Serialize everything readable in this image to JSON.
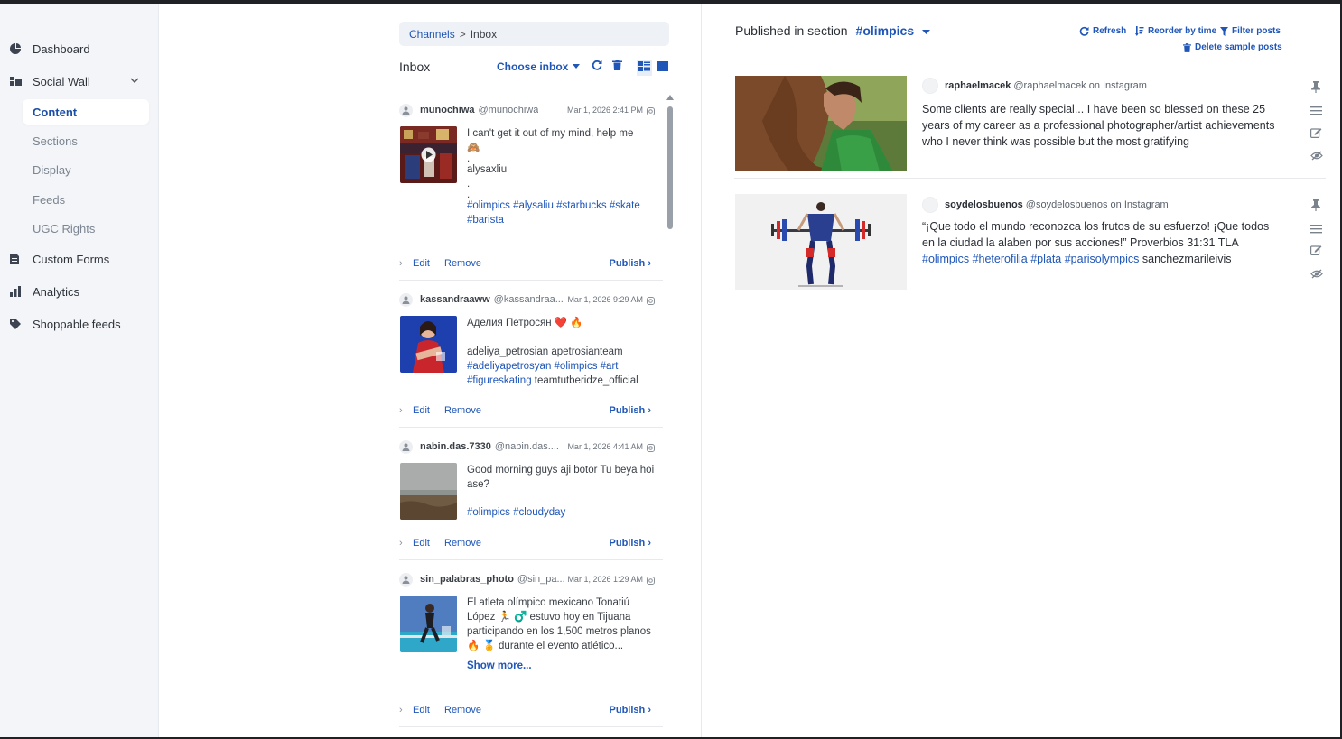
{
  "sidebar": {
    "items": [
      {
        "label": "Dashboard",
        "icon": "dashboard-icon"
      },
      {
        "label": "Social Wall",
        "icon": "social-wall-icon"
      },
      {
        "label": "Custom Forms",
        "icon": "form-icon"
      },
      {
        "label": "Analytics",
        "icon": "analytics-icon"
      },
      {
        "label": "Shoppable feeds",
        "icon": "tag-icon"
      }
    ],
    "social_wall_sub": [
      "Content",
      "Sections",
      "Display",
      "Feeds",
      "UGC Rights"
    ],
    "active_sub": "Content"
  },
  "breadcrumb": {
    "parent": "Channels",
    "separator": ">",
    "current": "Inbox"
  },
  "inbox": {
    "title": "Inbox",
    "choose_label": "Choose inbox",
    "cards": [
      {
        "name": "munochiwa",
        "handle": "@munochiwa",
        "date": "Mar 1, 2026 2:41 PM",
        "lines": [
          "I can't get it out of my mind, help me",
          "🙈",
          ".",
          "alysaxliu",
          ".",
          "."
        ],
        "tags": "#olimpics #alysaliu #starbucks #skate #barista",
        "edit": "Edit",
        "remove": "Remove",
        "publish": "Publish"
      },
      {
        "name": "kassandraaww",
        "handle": "@kassandraa...",
        "date": "Mar 1, 2026 9:29 AM",
        "lines": [
          "Аделия Петросян ❤️ 🔥",
          "",
          "adeliya_petrosian apetrosianteam"
        ],
        "tags": "#adeliyapetrosyan #olimpics #art #figureskating",
        "tail": " teamtutberidze_official",
        "edit": "Edit",
        "remove": "Remove",
        "publish": "Publish"
      },
      {
        "name": "nabin.das.7330",
        "handle": "@nabin.das....",
        "date": "Mar 1, 2026 4:41 AM",
        "lines": [
          "Good morning guys aji botor Tu beya hoi ase?",
          ""
        ],
        "tags": "#olimpics #cloudyday",
        "edit": "Edit",
        "remove": "Remove",
        "publish": "Publish"
      },
      {
        "name": "sin_palabras_photo",
        "handle": "@sin_pa...",
        "date": "Mar 1, 2026 1:29 AM",
        "lines": [
          "El atleta olímpico mexicano Tonatiú López 🏃 ♂️ estuvo hoy en Tijuana participando en los 1,500 metros planos 🔥 🏅 durante el evento atlético..."
        ],
        "show_more": "Show more...",
        "edit": "Edit",
        "remove": "Remove",
        "publish": "Publish"
      }
    ]
  },
  "published": {
    "prefix": "Published in section",
    "section": "#olimpics",
    "refresh": "Refresh",
    "reorder": "Reorder by time",
    "filter": "Filter posts",
    "delete_samples": "Delete sample posts",
    "posts": [
      {
        "name": "raphaelmacek",
        "handle": "@raphaelmacek on Instagram",
        "text": "Some clients are really special... I have been so blessed on these 25 years of my career as a professional photographer/artist achievements who I never think was possible but the most gratifying",
        "tags": "",
        "tail": ""
      },
      {
        "name": "soydelosbuenos",
        "handle": "@soydelosbuenos on Instagram",
        "text": "“¡Que todo el mundo reconozca los frutos de su esfuerzo! ¡Que todos en la ciudad la alaben por sus acciones!” Proverbios 31:31 TLA",
        "tags": "#olimpics #heterofilia #plata #parisolympics",
        "tail": " sanchezmarileivis"
      }
    ]
  },
  "colors": {
    "accent": "#1f56b8",
    "sidebar_bg": "#f3f5f8",
    "text": "#2b2f36"
  }
}
